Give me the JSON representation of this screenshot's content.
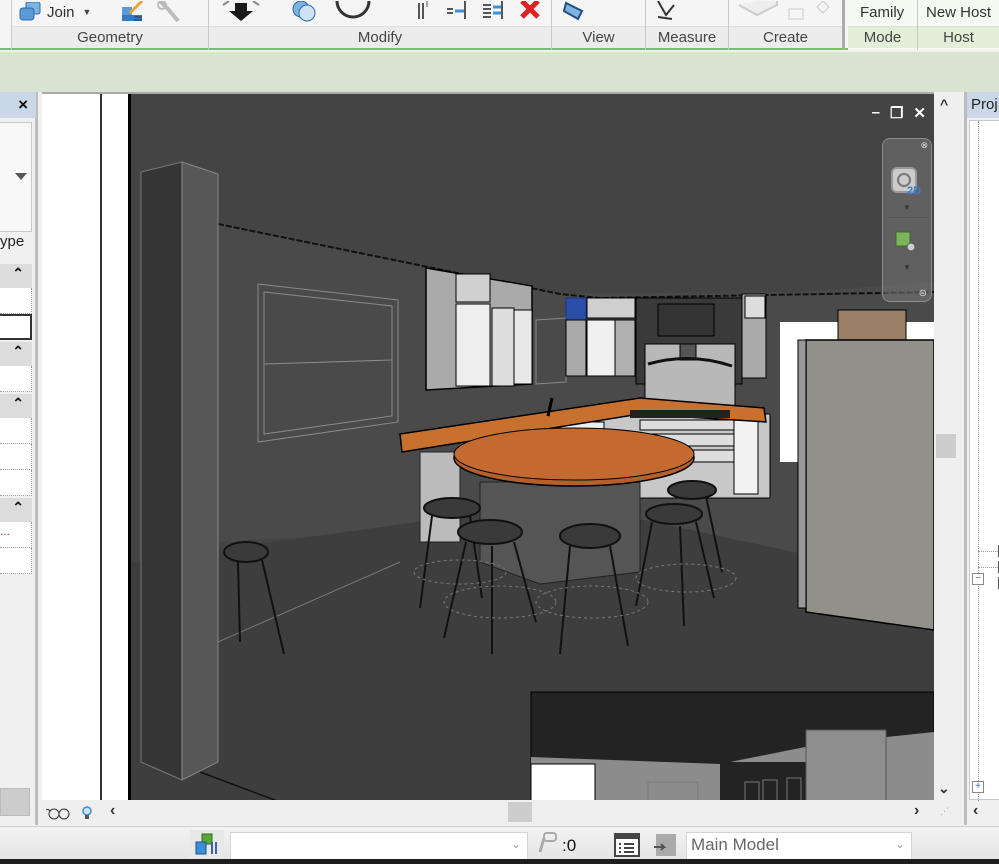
{
  "ribbon": {
    "tools": {
      "join_label": "Join",
      "family_label": "Family",
      "new_host_label": "New Host"
    },
    "panels": [
      {
        "id": "geometry",
        "label": "Geometry"
      },
      {
        "id": "modify",
        "label": "Modify"
      },
      {
        "id": "view",
        "label": "View"
      },
      {
        "id": "measure",
        "label": "Measure"
      },
      {
        "id": "create",
        "label": "Create"
      },
      {
        "id": "mode",
        "label": "Mode"
      },
      {
        "id": "host",
        "label": "Host"
      }
    ],
    "accent_color": "#7dc15a"
  },
  "properties_panel": {
    "close_label": "×",
    "type_label_fragment": "ype",
    "group_collapse_icon": "«",
    "truncated_value": "..."
  },
  "view": {
    "window_controls": {
      "minimize": "–",
      "restore": "❐",
      "close": "✕"
    },
    "navigation_bar": {
      "wheel_label": "2D"
    },
    "selection_color": "#2b4fa8"
  },
  "project_browser": {
    "title_fragment": "Proj"
  },
  "status_bar": {
    "editable_count": ":0",
    "active_workset": "Main Model",
    "design_option_input": ""
  }
}
